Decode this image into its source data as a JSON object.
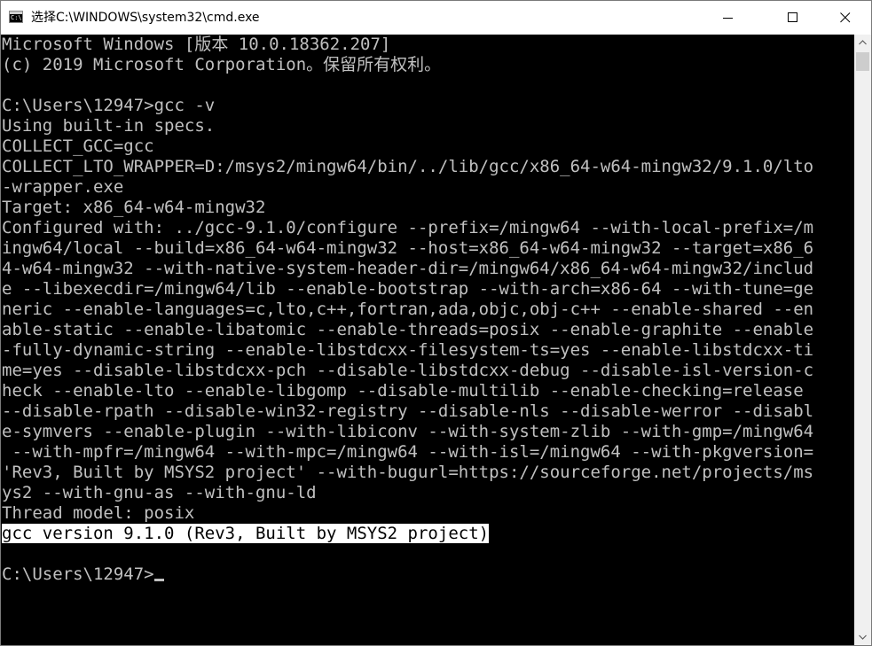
{
  "window": {
    "title": "选择C:\\WINDOWS\\system32\\cmd.exe",
    "icon": "cmd-icon"
  },
  "titlebar_buttons": {
    "minimize": "minimize-icon",
    "maximize": "maximize-icon",
    "close": "close-icon"
  },
  "console": {
    "lines": [
      "Microsoft Windows [版本 10.0.18362.207]",
      "(c) 2019 Microsoft Corporation。保留所有权利。",
      "",
      "C:\\Users\\12947>gcc -v",
      "Using built-in specs.",
      "COLLECT_GCC=gcc",
      "COLLECT_LTO_WRAPPER=D:/msys2/mingw64/bin/../lib/gcc/x86_64-w64-mingw32/9.1.0/lto",
      "-wrapper.exe",
      "Target: x86_64-w64-mingw32",
      "Configured with: ../gcc-9.1.0/configure --prefix=/mingw64 --with-local-prefix=/m",
      "ingw64/local --build=x86_64-w64-mingw32 --host=x86_64-w64-mingw32 --target=x86_6",
      "4-w64-mingw32 --with-native-system-header-dir=/mingw64/x86_64-w64-mingw32/includ",
      "e --libexecdir=/mingw64/lib --enable-bootstrap --with-arch=x86-64 --with-tune=ge",
      "neric --enable-languages=c,lto,c++,fortran,ada,objc,obj-c++ --enable-shared --en",
      "able-static --enable-libatomic --enable-threads=posix --enable-graphite --enable",
      "-fully-dynamic-string --enable-libstdcxx-filesystem-ts=yes --enable-libstdcxx-ti",
      "me=yes --disable-libstdcxx-pch --disable-libstdcxx-debug --disable-isl-version-c",
      "heck --enable-lto --enable-libgomp --disable-multilib --enable-checking=release",
      "--disable-rpath --disable-win32-registry --disable-nls --disable-werror --disabl",
      "e-symvers --enable-plugin --with-libiconv --with-system-zlib --with-gmp=/mingw64",
      " --with-mpfr=/mingw64 --with-mpc=/mingw64 --with-isl=/mingw64 --with-pkgversion=",
      "'Rev3, Built by MSYS2 project' --with-bugurl=https://sourceforge.net/projects/ms",
      "ys2 --with-gnu-as --with-gnu-ld",
      "Thread model: posix"
    ],
    "selected_line": "gcc version 9.1.0 (Rev3, Built by MSYS2 project)",
    "blank_line": "",
    "prompt": "C:\\Users\\12947>"
  },
  "colors": {
    "console_bg": "#000000",
    "console_fg": "#c0c0c0",
    "selection_bg": "#ffffff",
    "selection_fg": "#000000",
    "scrollbar_bg": "#f0f0f0",
    "scrollbar_thumb": "#cdcdcd"
  },
  "scrollbar": {
    "up": "scroll-up-arrow-icon",
    "down": "scroll-down-arrow-icon"
  }
}
